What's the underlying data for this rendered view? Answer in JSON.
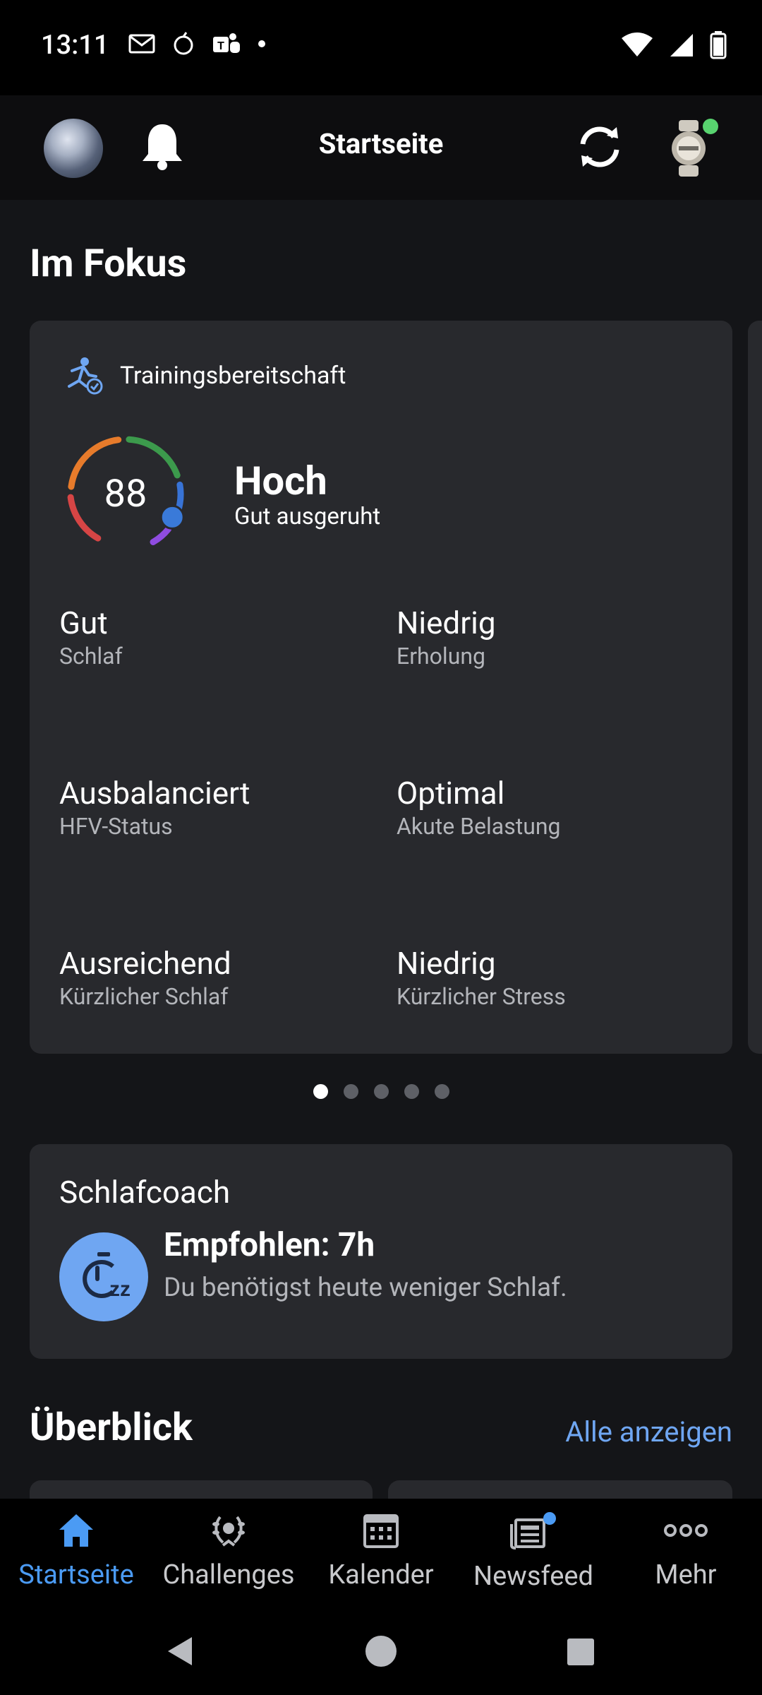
{
  "status": {
    "time": "13:11"
  },
  "appbar": {
    "title": "Startseite"
  },
  "focus": {
    "title": "Im Fokus",
    "card": {
      "label": "Trainingsbereitschaft",
      "score": "88",
      "score_fraction": 0.88,
      "level": "Hoch",
      "level_sub": "Gut ausgeruht",
      "metrics": [
        {
          "value": "Gut",
          "label": "Schlaf"
        },
        {
          "value": "Niedrig",
          "label": "Erholung"
        },
        {
          "value": "Ausbalanciert",
          "label": "HFV-Status"
        },
        {
          "value": "Optimal",
          "label": "Akute Belastung"
        },
        {
          "value": "Ausreichend",
          "label": "Kürzlicher Schlaf"
        },
        {
          "value": "Niedrig",
          "label": "Kürzlicher Stress"
        }
      ]
    },
    "pager": {
      "count": 5,
      "active": 1
    }
  },
  "sleepcoach": {
    "title": "Schlafcoach",
    "headline": "Empfohlen: 7h",
    "subtitle": "Du benötigst heute weniger Schlaf."
  },
  "overview": {
    "title": "Überblick",
    "see_all": "Alle anzeigen"
  },
  "nav": {
    "items": [
      {
        "label": "Startseite",
        "icon": "home-icon"
      },
      {
        "label": "Challenges",
        "icon": "laurel-icon"
      },
      {
        "label": "Kalender",
        "icon": "calendar-icon"
      },
      {
        "label": "Newsfeed",
        "icon": "newsfeed-icon"
      },
      {
        "label": "Mehr",
        "icon": "more-icon"
      }
    ]
  },
  "colors": {
    "accent": "#4b9bf4",
    "link": "#6fa6f2",
    "card": "#28292d",
    "background": "#141518"
  }
}
